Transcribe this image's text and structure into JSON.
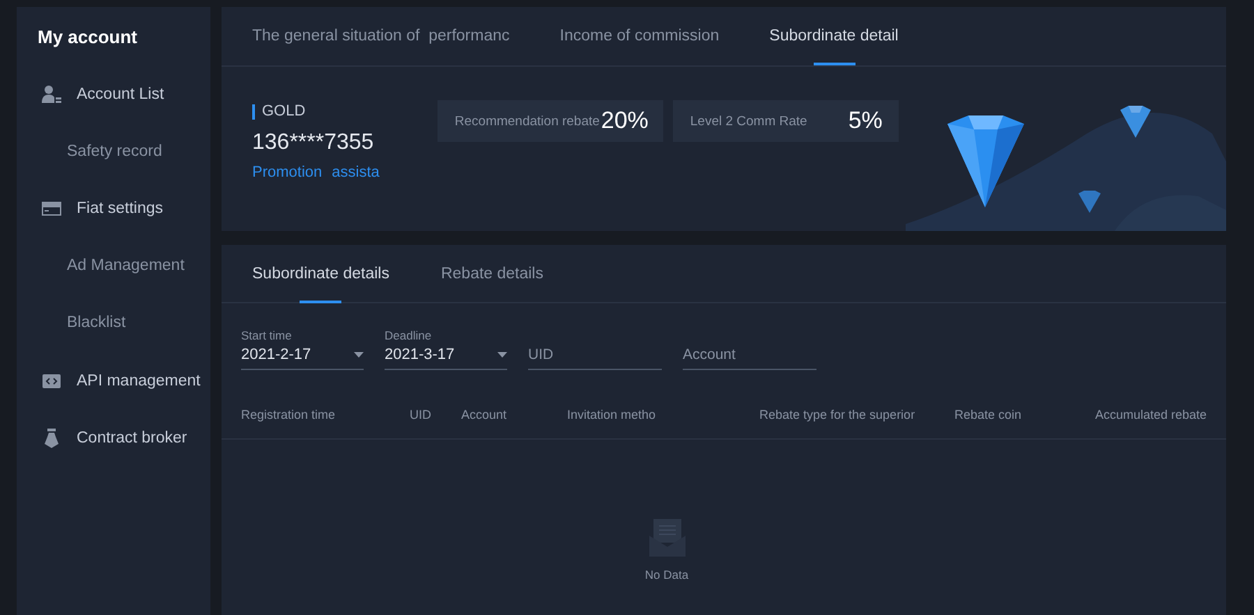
{
  "sidebar": {
    "title": "My account",
    "items": [
      {
        "kind": "group",
        "label": "Account List"
      },
      {
        "kind": "sub",
        "label": "Safety record"
      },
      {
        "kind": "group",
        "label": "Fiat settings"
      },
      {
        "kind": "sub",
        "label": "Ad Management"
      },
      {
        "kind": "sub",
        "label": "Blacklist"
      },
      {
        "kind": "group",
        "label": "API management"
      },
      {
        "kind": "group",
        "label": "Contract broker"
      }
    ]
  },
  "top_tabs": [
    {
      "label": "The general situation of  performanc",
      "selected": false
    },
    {
      "label": "Income of commission",
      "selected": false
    },
    {
      "label": "Subordinate detail",
      "selected": true
    }
  ],
  "profile": {
    "level": "GOLD",
    "account": "136****7355",
    "links": [
      "Promotion",
      "assista"
    ]
  },
  "stats": [
    {
      "label": "Recommendation rebate",
      "value": "20%"
    },
    {
      "label": "Level 2 Comm Rate",
      "value": "5%"
    }
  ],
  "sub_tabs": [
    {
      "label": "Subordinate details",
      "selected": true
    },
    {
      "label": "Rebate details",
      "selected": false
    }
  ],
  "filters": [
    {
      "kind": "select",
      "label": "Start time",
      "value": "2021-2-17"
    },
    {
      "kind": "select",
      "label": "Deadline",
      "value": "2021-3-17"
    },
    {
      "kind": "text",
      "placeholder": "UID"
    },
    {
      "kind": "text",
      "placeholder": "Account"
    }
  ],
  "table": {
    "columns": [
      "Registration time",
      "UID",
      "Account",
      "Invitation metho",
      "Rebate type for the superior",
      "Rebate coin",
      "Accumulated rebate"
    ],
    "empty_text": "No Data"
  }
}
